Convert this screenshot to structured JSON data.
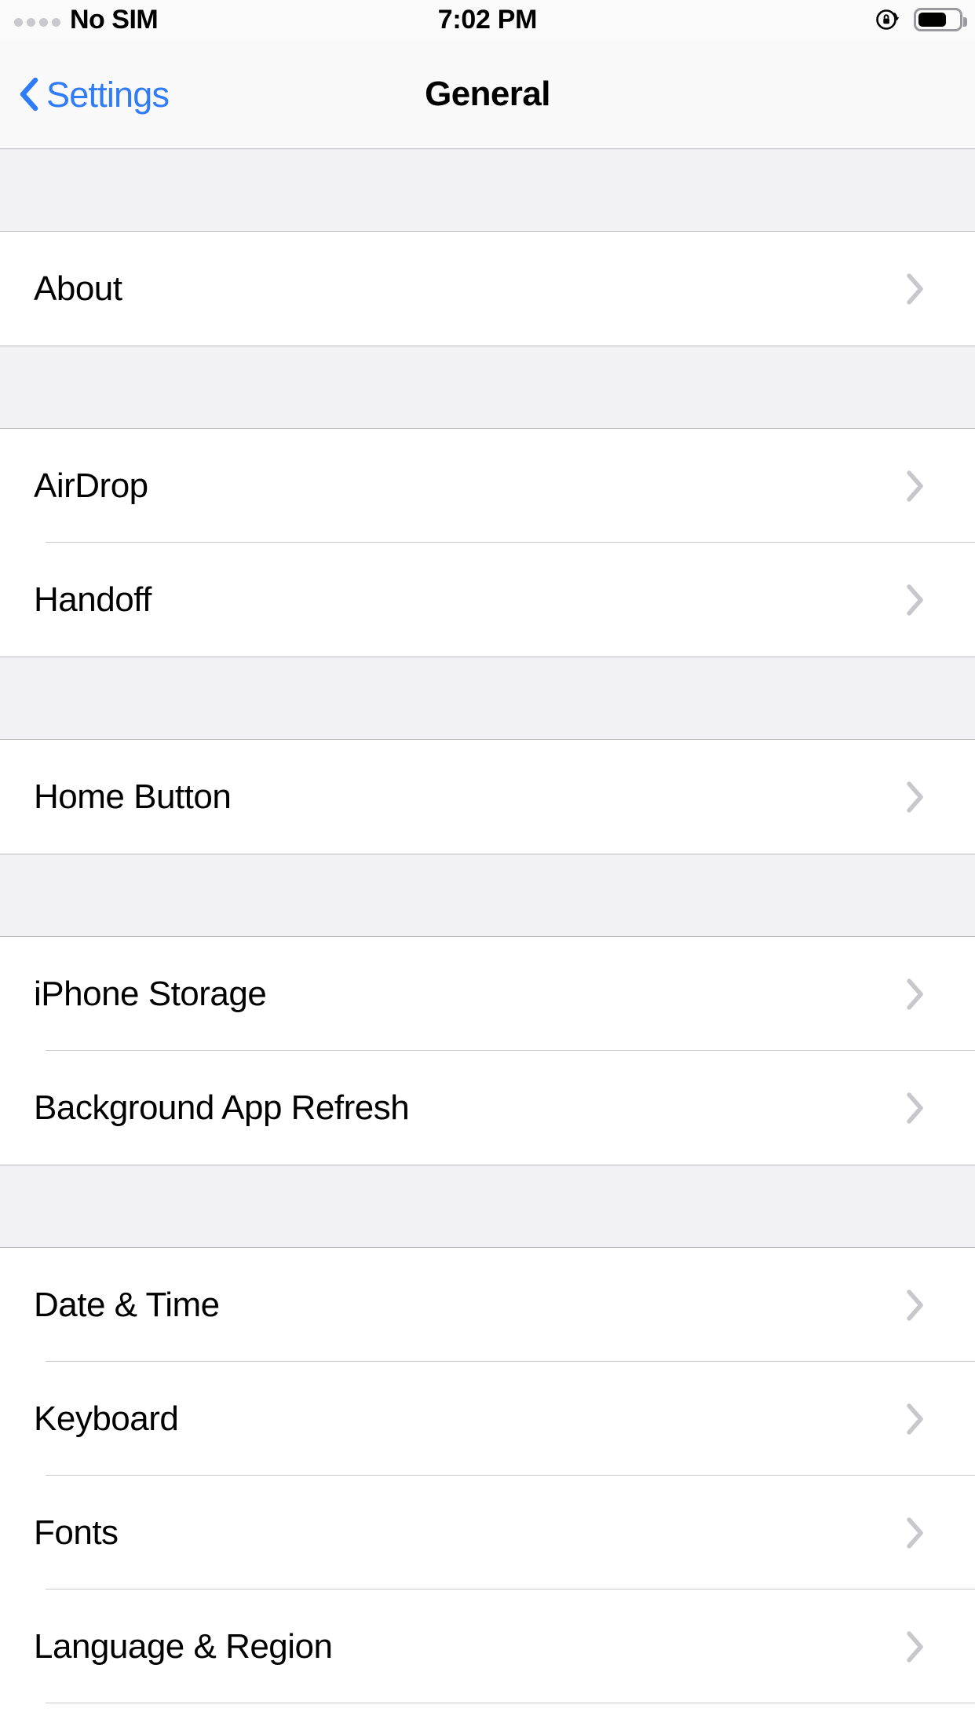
{
  "status_bar": {
    "carrier": "No SIM",
    "signal_icon": "signal-dots-empty",
    "signal_dots": 4,
    "time": "7:02 PM",
    "rotation_lock_icon": "rotation-lock-icon",
    "battery_icon": "battery-icon",
    "battery_level_percent": 80
  },
  "nav_bar": {
    "back_icon": "chevron-left-icon",
    "back_label": "Settings",
    "title": "General"
  },
  "colors": {
    "accent_blue": "#2f7cf6",
    "group_background": "#f2f1f6",
    "chevron_gray": "#c7c7cc",
    "separator": "#c8c7cc",
    "nav_background": "#f9f9f9"
  },
  "sections": [
    {
      "rows": [
        {
          "label": "About",
          "accessory": "chevron-right-icon"
        }
      ]
    },
    {
      "rows": [
        {
          "label": "AirDrop",
          "accessory": "chevron-right-icon"
        },
        {
          "label": "Handoff",
          "accessory": "chevron-right-icon"
        }
      ]
    },
    {
      "rows": [
        {
          "label": "Home Button",
          "accessory": "chevron-right-icon"
        }
      ]
    },
    {
      "rows": [
        {
          "label": "iPhone Storage",
          "accessory": "chevron-right-icon"
        },
        {
          "label": "Background App Refresh",
          "accessory": "chevron-right-icon"
        }
      ]
    },
    {
      "rows": [
        {
          "label": "Date & Time",
          "accessory": "chevron-right-icon"
        },
        {
          "label": "Keyboard",
          "accessory": "chevron-right-icon"
        },
        {
          "label": "Fonts",
          "accessory": "chevron-right-icon"
        },
        {
          "label": "Language & Region",
          "accessory": "chevron-right-icon"
        }
      ]
    }
  ]
}
